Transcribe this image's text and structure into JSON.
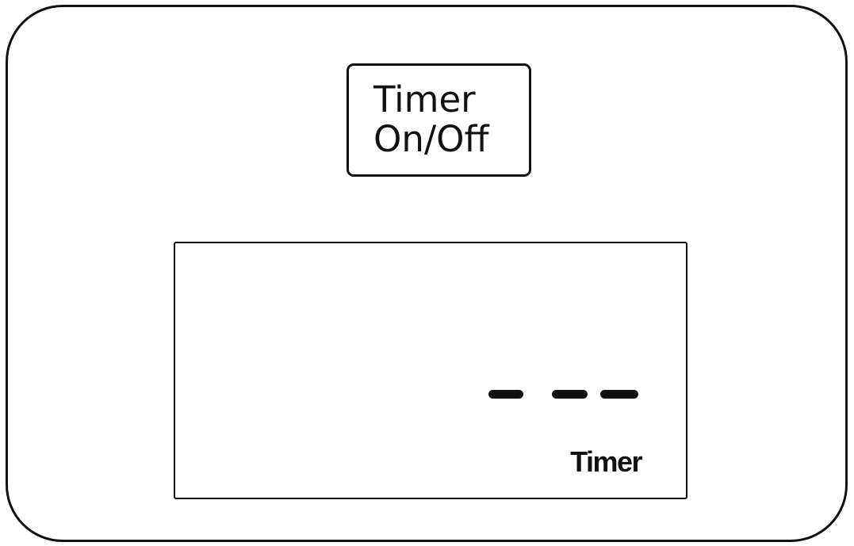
{
  "control_panel": {
    "timer_button": {
      "line1": "Timer",
      "line2": "On/Off"
    },
    "display": {
      "segments": "- - -",
      "indicator_label": "Timer"
    }
  }
}
